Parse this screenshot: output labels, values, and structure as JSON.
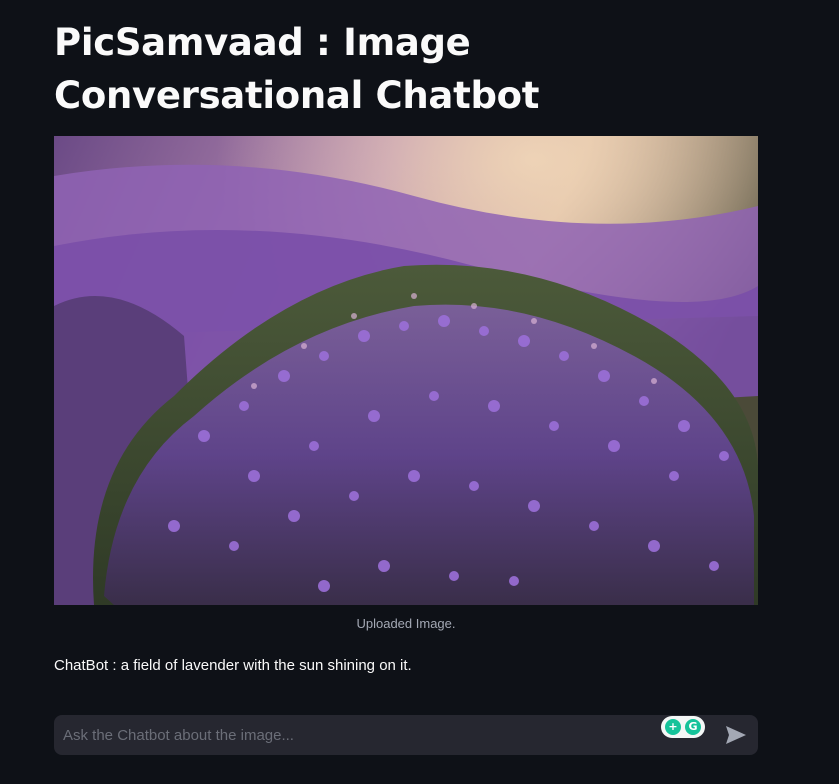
{
  "header": {
    "title": "PicSamvaad : Image Conversational Chatbot"
  },
  "image": {
    "caption": "Uploaded Image.",
    "icon": "lavender-field-photo"
  },
  "conversation": {
    "answer": "ChatBot : a field of lavender with the sun shining on it."
  },
  "chat_input": {
    "placeholder": "Ask the Chatbot about the image...",
    "value": "",
    "send_icon": "send-icon",
    "extension_icon": "grammarly-icon"
  },
  "colors": {
    "background": "#0e1117",
    "input_background": "#262730",
    "text": "#fafafa",
    "caption": "#a3a8b4",
    "grammarly_green": "#15c39a"
  }
}
